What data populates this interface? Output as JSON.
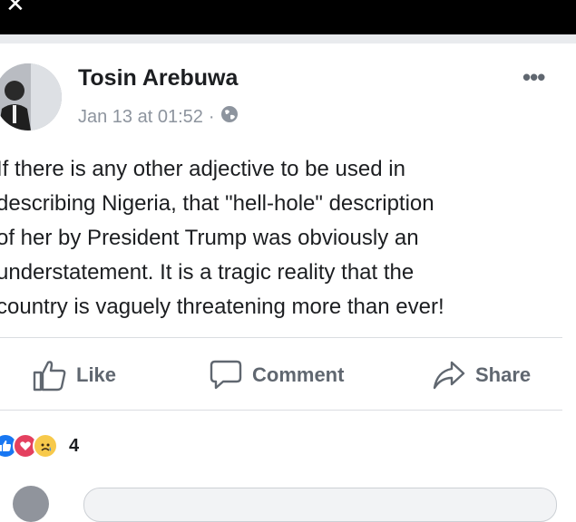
{
  "post": {
    "author": "Tosin Arebuwa",
    "timestamp": "Jan 13 at 01:52",
    "separator": "·",
    "privacy_icon": "globe-icon",
    "more_label": "•••",
    "text": "If there is any other adjective to be used in\ndescribing Nigeria, that \"hell-hole\" description\nof her by President Trump was obviously an\nunderstatement. It is a tragic reality that the\ncountry is vaguely threatening more than ever!"
  },
  "actions": {
    "like_label": "Like",
    "comment_label": "Comment",
    "share_label": "Share"
  },
  "reactions": {
    "icons": [
      "like-reaction-icon",
      "love-reaction-icon",
      "sad-reaction-icon"
    ],
    "count": "4"
  },
  "colors": {
    "top_bar": "#000000",
    "text": "#1c1e21",
    "meta": "#8d949e",
    "action": "#606770",
    "like_blue": "#1877f2",
    "love_red": "#e4405f",
    "sad_yellow": "#f7c94b"
  }
}
